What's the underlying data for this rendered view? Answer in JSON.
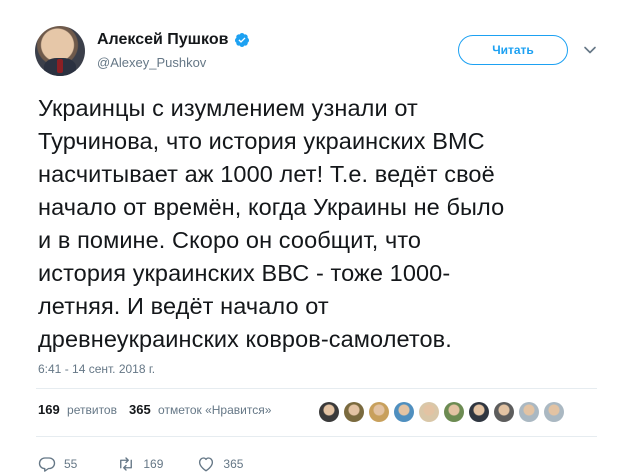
{
  "author": {
    "name": "Алексей Пушков",
    "handle": "@Alexey_Pushkov"
  },
  "follow_button": {
    "label": "Читать"
  },
  "tweet": {
    "text": "Украинцы с изумлением узнали от\nТурчинова, что история украинских ВМС\nнасчитывает аж 1000 лет! Т.е. ведёт своё\nначало от времён, когда Украины не было\nи в помине. Скоро он сообщит, что\nистория украинских ВВС - тоже 1000-\nлетняя. И ведёт начало от\nдревнеукраинских ковров-самолетов.",
    "timestamp": "6:41 - 14 сент. 2018 г."
  },
  "stats": {
    "retweets_count": "169",
    "retweets_label": "ретвитов",
    "likes_count": "365",
    "likes_label": "отметок «Нравится»"
  },
  "liker_faces": [
    {
      "icon": "face-avatar",
      "color": "#3a3a3a"
    },
    {
      "icon": "face-avatar",
      "color": "#7a6a3e"
    },
    {
      "icon": "face-avatar",
      "color": "#c8a05c"
    },
    {
      "icon": "face-avatar",
      "color": "#4f8fbf"
    },
    {
      "icon": "face-avatar",
      "color": "#d9c7a8"
    },
    {
      "icon": "face-avatar",
      "color": "#6c8b52"
    },
    {
      "icon": "face-avatar",
      "color": "#2f3640"
    },
    {
      "icon": "face-avatar",
      "color": "#5d5d5d"
    },
    {
      "icon": "face-avatar",
      "color": "#aab8c2"
    },
    {
      "icon": "face-avatar",
      "color": "#aab8c2"
    }
  ],
  "actions": {
    "reply_count": "55",
    "retweet_count": "169",
    "like_count": "365"
  },
  "colors": {
    "accent": "#1da1f2",
    "muted": "#657786",
    "text": "#14171a",
    "divider": "#e6ecf0"
  }
}
